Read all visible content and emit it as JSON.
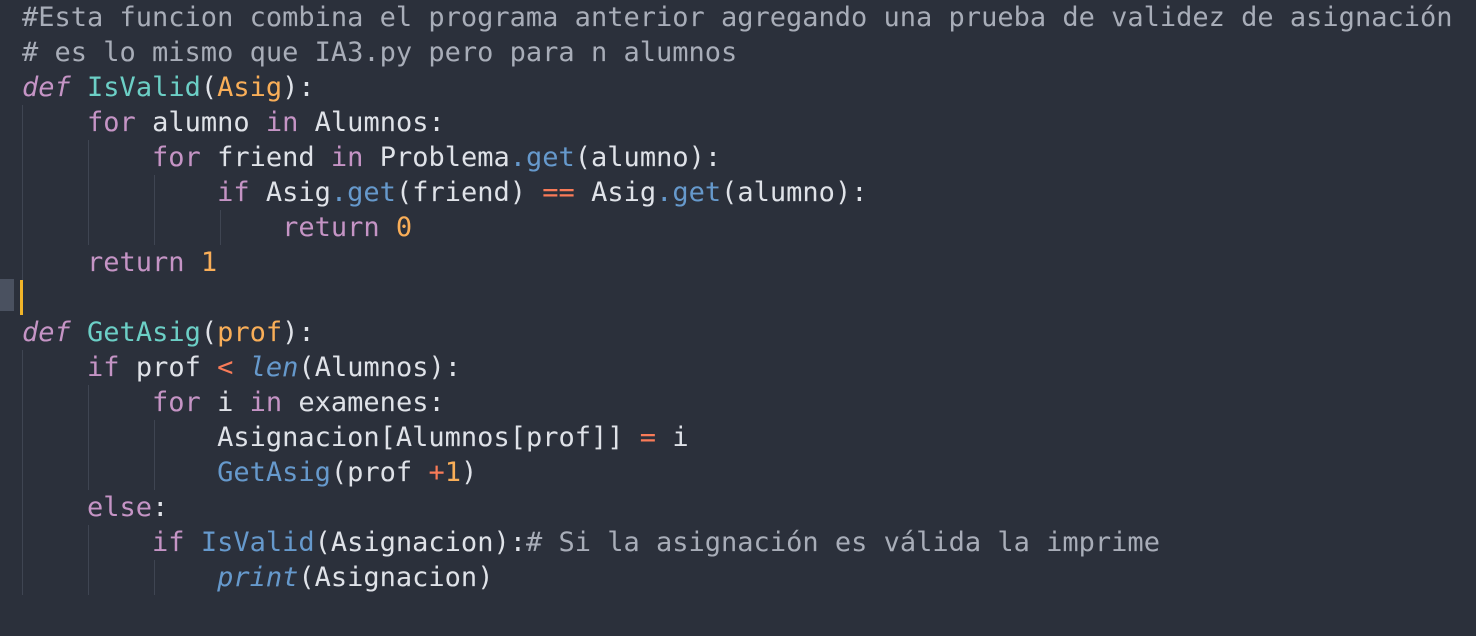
{
  "editor": {
    "language": "python",
    "theme_colors": {
      "background": "#2b303b",
      "text": "#dfe2e8",
      "comment": "#a8adb8",
      "keyword": "#c594c5",
      "function": "#6ccfc6",
      "parameter": "#f9ae58",
      "operator": "#f97b58",
      "method": "#6699cc",
      "caret": "#f0b429"
    },
    "lines": [
      "#Esta funcion combina el programa anterior agregando una prueba de validez de asignación",
      "# es lo mismo que IA3.py pero para n alumnos",
      "def IsValid(Asig):",
      "    for alumno in Alumnos:",
      "        for friend in Problema.get(alumno):",
      "            if Asig.get(friend) == Asig.get(alumno):",
      "                return 0",
      "    return 1",
      "",
      "def GetAsig(prof):",
      "    if prof < len(Alumnos):",
      "        for i in examenes:",
      "            Asignacion[Alumnos[prof]] = i",
      "            GetAsig(prof +1)",
      "    else:",
      "        if IsValid(Asignacion):# Si la asignación es válida la imprime",
      "            print(Asignacion)"
    ]
  }
}
